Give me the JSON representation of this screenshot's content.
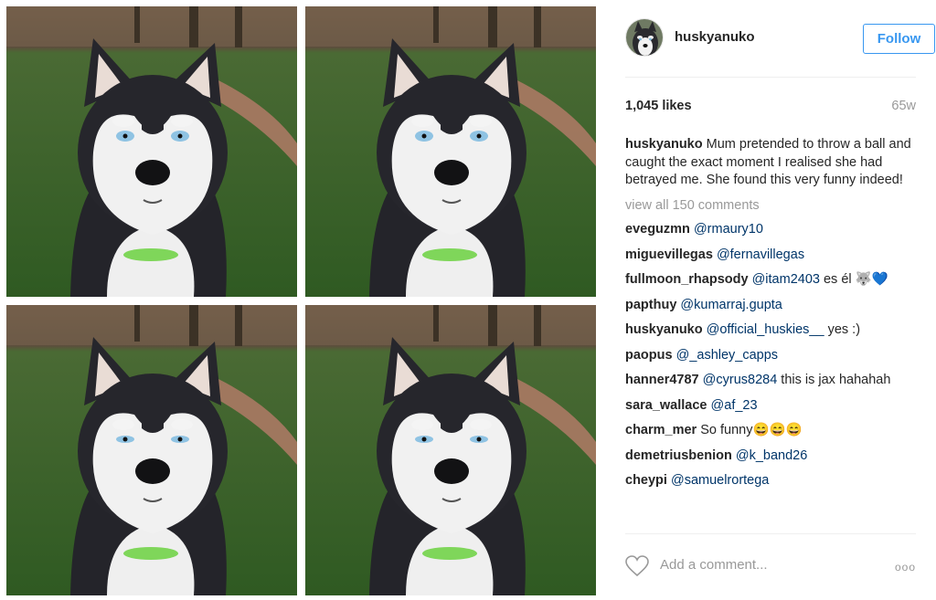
{
  "post": {
    "photos": [
      {
        "alt": "husky photo 1"
      },
      {
        "alt": "husky photo 2"
      },
      {
        "alt": "husky photo 3"
      },
      {
        "alt": "husky photo 4"
      }
    ]
  },
  "header": {
    "username": "huskyanuko",
    "follow_label": "Follow",
    "avatar_icon": "husky-avatar-icon"
  },
  "stats": {
    "likes": "1,045 likes",
    "age": "65w"
  },
  "caption": {
    "user": "huskyanuko",
    "text": "Mum pretended to throw a ball and caught the exact moment I realised she had betrayed me. She found this very funny indeed!"
  },
  "view_all": "view all 150 comments",
  "comments": [
    {
      "user": "eveguzmn",
      "mention": "@rmaury10",
      "text": ""
    },
    {
      "user": "miguevillegas",
      "mention": "@fernavillegas",
      "text": ""
    },
    {
      "user": "fullmoon_rhapsody",
      "mention": "@itam2403",
      "text": " es él 🐺💙"
    },
    {
      "user": "papthuy",
      "mention": "@kumarraj.gupta",
      "text": ""
    },
    {
      "user": "huskyanuko",
      "mention": "@official_huskies__",
      "text": " yes :)"
    },
    {
      "user": "paopus",
      "mention": "@_ashley_capps",
      "text": ""
    },
    {
      "user": "hanner4787",
      "mention": "@cyrus8284",
      "text": " this is jax hahahah"
    },
    {
      "user": "sara_wallace",
      "mention": "@af_23",
      "text": ""
    },
    {
      "user": "charm_mer",
      "mention": "",
      "text": "So funny😄😄😄"
    },
    {
      "user": "demetriusbenion",
      "mention": "@k_band26",
      "text": ""
    },
    {
      "user": "cheypi",
      "mention": "@samuelrortega",
      "text": ""
    }
  ],
  "footer": {
    "comment_placeholder": "Add a comment...",
    "more_label": "ooo",
    "heart_icon": "heart-icon"
  },
  "colors": {
    "accent": "#3897f0",
    "mention": "#003569",
    "muted": "#999999",
    "text": "#262626"
  }
}
